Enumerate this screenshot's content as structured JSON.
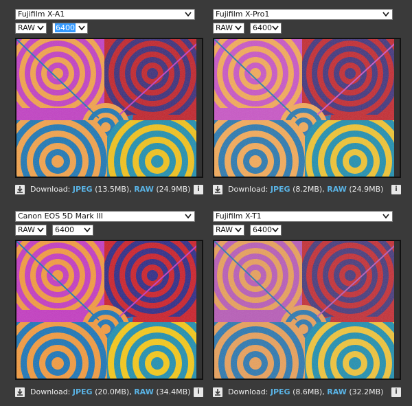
{
  "panes": [
    {
      "camera": "Fujifilm X-A1",
      "format": "RAW",
      "iso": "6400",
      "iso_selected": true,
      "download_label": "Download:",
      "jpeg_label": "JPEG",
      "jpeg_size": "(13.5MB),",
      "raw_label": "RAW",
      "raw_size": "(24.9MB)",
      "info": "i"
    },
    {
      "camera": "Fujifilm X-Pro1",
      "format": "RAW",
      "iso": "6400",
      "iso_selected": false,
      "download_label": "Download:",
      "jpeg_label": "JPEG",
      "jpeg_size": "(8.2MB),",
      "raw_label": "RAW",
      "raw_size": "(24.9MB)",
      "info": "i"
    },
    {
      "camera": "Canon EOS 5D Mark III",
      "format": "RAW",
      "iso": "6400",
      "iso_selected": false,
      "download_label": "Download:",
      "jpeg_label": "JPEG",
      "jpeg_size": "(20.0MB),",
      "raw_label": "RAW",
      "raw_size": "(34.4MB)",
      "info": "i"
    },
    {
      "camera": "Fujifilm X-T1",
      "format": "RAW",
      "iso": "6400",
      "iso_selected": false,
      "download_label": "Download:",
      "jpeg_label": "JPEG",
      "jpeg_size": "(8.6MB),",
      "raw_label": "RAW",
      "raw_size": "(32.2MB)",
      "info": "i"
    }
  ],
  "colors": {
    "accent_link": "#5ab4e6",
    "background": "#3a3a3a",
    "selection": "#3399ff"
  },
  "icons": {
    "download": "download-icon",
    "info": "info-icon",
    "dropdown": "chevron-down-icon"
  }
}
